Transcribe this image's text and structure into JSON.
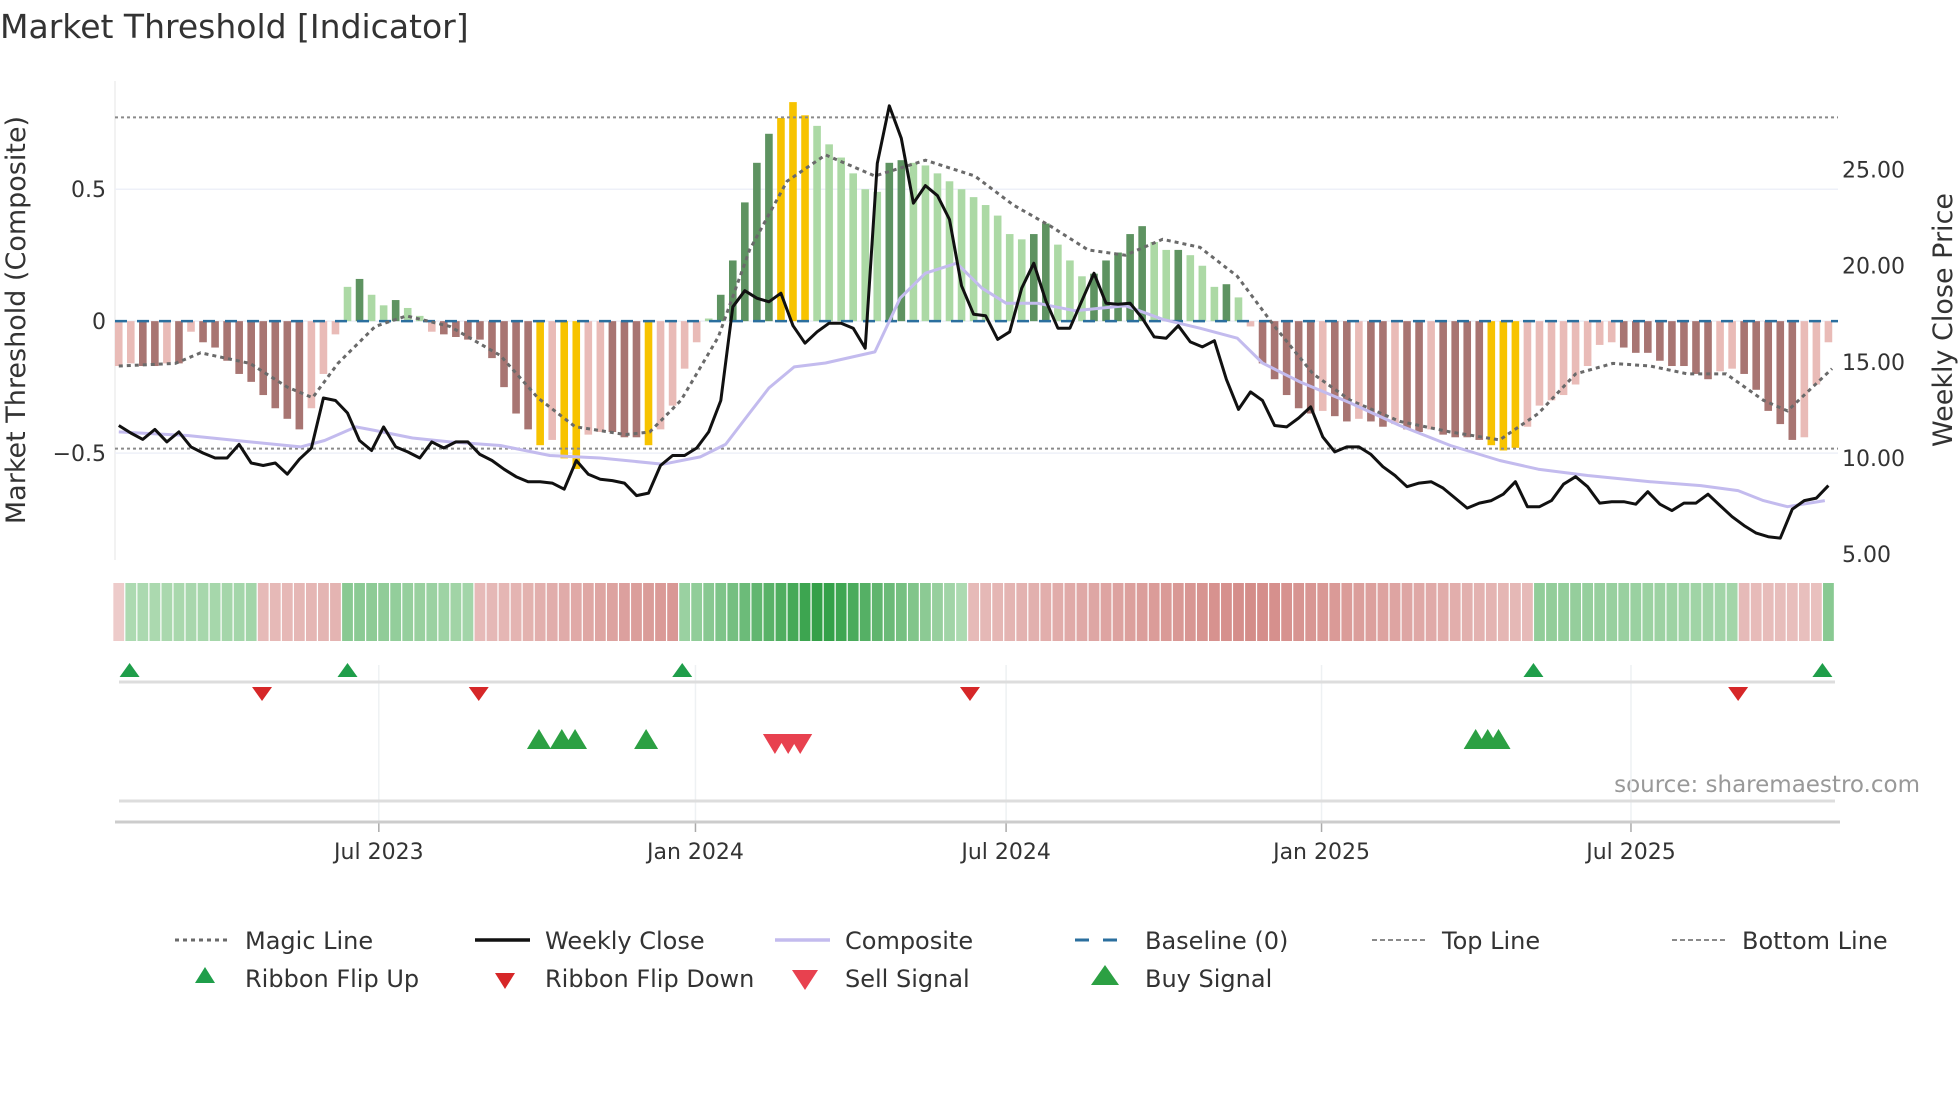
{
  "title": "Market Threshold [Indicator]",
  "source": "source: sharemaestro.com",
  "colors": {
    "bar_up_strong": "#5e9361",
    "bar_up_weak": "#acd9a5",
    "bar_down_strong": "#a87572",
    "bar_down_weak": "#e9bbb7",
    "bar_extreme": "#f7c300",
    "close": "#111111",
    "composite": "#c3bbee",
    "magic": "#6a6a6a",
    "baseline": "#2b6f9e",
    "threshold": "#8a8a8a",
    "flip_up": "#1f9e4a",
    "flip_down": "#d62728",
    "buy": "#2ca043",
    "sell": "#e8414f"
  },
  "chart_data": {
    "type": "bar+line",
    "title": "Market Threshold [Indicator]",
    "ylabel": "Market Threshold (Composite)",
    "y2label": "Weekly Close Price",
    "ylim": [
      -0.905,
      0.91
    ],
    "y2lim": [
      4.7,
      29.6
    ],
    "yticks": [
      {
        "v": 0.5,
        "label": "0.5"
      },
      {
        "v": 0,
        "label": "0"
      },
      {
        "v": -0.5,
        "label": "−0.5"
      }
    ],
    "y2ticks": [
      {
        "v": 25,
        "label": "25.00"
      },
      {
        "v": 20,
        "label": "20.00"
      },
      {
        "v": 15,
        "label": "15.00"
      },
      {
        "v": 10,
        "label": "10.00"
      },
      {
        "v": 5,
        "label": "5.00"
      }
    ],
    "xticks": [
      {
        "week": 21.6,
        "label": "Jul 2023"
      },
      {
        "week": 47.9,
        "label": "Jan 2024"
      },
      {
        "week": 73.7,
        "label": "Jul 2024"
      },
      {
        "week": 99.9,
        "label": "Jan 2025"
      },
      {
        "week": 125.6,
        "label": "Jul 2025"
      }
    ],
    "top_line": 0.772,
    "bottom_line": -0.483,
    "baseline": 0,
    "extreme_thresholds": [
      -0.465,
      0.75
    ],
    "composite_histogram": [
      -0.17,
      -0.16,
      -0.17,
      -0.17,
      -0.16,
      -0.16,
      -0.04,
      -0.08,
      -0.1,
      -0.15,
      -0.2,
      -0.23,
      -0.28,
      -0.33,
      -0.37,
      -0.41,
      -0.33,
      -0.2,
      -0.05,
      0.13,
      0.16,
      0.1,
      0.06,
      0.08,
      0.05,
      0.02,
      -0.04,
      -0.05,
      -0.06,
      -0.07,
      -0.07,
      -0.14,
      -0.25,
      -0.35,
      -0.41,
      -0.47,
      -0.45,
      -0.52,
      -0.56,
      -0.43,
      -0.42,
      -0.42,
      -0.44,
      -0.44,
      -0.47,
      -0.41,
      -0.32,
      -0.18,
      -0.08,
      0.01,
      0.1,
      0.23,
      0.45,
      0.6,
      0.71,
      0.77,
      0.83,
      0.78,
      0.74,
      0.67,
      0.62,
      0.56,
      0.5,
      0.49,
      0.6,
      0.61,
      0.6,
      0.59,
      0.56,
      0.53,
      0.5,
      0.47,
      0.44,
      0.4,
      0.33,
      0.31,
      0.33,
      0.37,
      0.29,
      0.23,
      0.17,
      0.18,
      0.23,
      0.26,
      0.33,
      0.36,
      0.3,
      0.27,
      0.27,
      0.25,
      0.21,
      0.13,
      0.14,
      0.09,
      -0.02,
      -0.16,
      -0.22,
      -0.28,
      -0.33,
      -0.35,
      -0.34,
      -0.36,
      -0.38,
      -0.37,
      -0.38,
      -0.4,
      -0.39,
      -0.41,
      -0.42,
      -0.41,
      -0.43,
      -0.44,
      -0.44,
      -0.45,
      -0.47,
      -0.49,
      -0.48,
      -0.4,
      -0.32,
      -0.3,
      -0.28,
      -0.24,
      -0.17,
      -0.09,
      -0.08,
      -0.1,
      -0.12,
      -0.12,
      -0.15,
      -0.17,
      -0.17,
      -0.2,
      -0.22,
      -0.19,
      -0.18,
      -0.2,
      -0.26,
      -0.34,
      -0.39,
      -0.45,
      -0.44,
      -0.24,
      -0.08
    ],
    "weekly_close": [
      11.69,
      11.3,
      10.97,
      11.49,
      10.84,
      11.36,
      10.58,
      10.26,
      10.0,
      10.0,
      10.71,
      9.74,
      9.61,
      9.74,
      9.16,
      9.94,
      10.52,
      13.12,
      12.99,
      12.34,
      10.91,
      10.39,
      11.62,
      10.58,
      10.32,
      10.0,
      10.84,
      10.52,
      10.84,
      10.84,
      10.19,
      9.87,
      9.42,
      9.03,
      8.77,
      8.77,
      8.7,
      8.38,
      9.87,
      9.16,
      8.9,
      8.83,
      8.7,
      8.05,
      8.18,
      9.61,
      10.13,
      10.13,
      10.52,
      11.36,
      12.99,
      17.86,
      18.7,
      18.31,
      18.12,
      18.57,
      16.88,
      15.97,
      16.56,
      17.01,
      17.01,
      16.75,
      15.71,
      25.32,
      28.31,
      26.62,
      23.25,
      24.16,
      23.64,
      22.4,
      18.96,
      17.47,
      17.4,
      16.17,
      16.56,
      18.83,
      20.13,
      18.18,
      16.75,
      16.75,
      18.18,
      19.61,
      18.05,
      17.99,
      18.05,
      17.27,
      16.3,
      16.23,
      16.88,
      16.04,
      15.78,
      16.1,
      14.09,
      12.53,
      13.44,
      12.99,
      11.69,
      11.62,
      12.08,
      12.66,
      11.1,
      10.32,
      10.58,
      10.58,
      10.19,
      9.55,
      9.09,
      8.51,
      8.7,
      8.77,
      8.44,
      7.92,
      7.4,
      7.66,
      7.79,
      8.12,
      8.77,
      7.47,
      7.47,
      7.79,
      8.64,
      9.03,
      8.51,
      7.66,
      7.73,
      7.73,
      7.6,
      8.25,
      7.6,
      7.27,
      7.66,
      7.66,
      8.12,
      7.53,
      6.95,
      6.49,
      6.1,
      5.91,
      5.84,
      7.34,
      7.79,
      7.92,
      8.57
    ],
    "composite_line": [
      [
        0,
        11.36
      ],
      [
        5.7,
        11.17
      ],
      [
        10.9,
        10.84
      ],
      [
        15.1,
        10.58
      ],
      [
        17.1,
        10.91
      ],
      [
        19.7,
        11.62
      ],
      [
        21.3,
        11.43
      ],
      [
        24.4,
        11.04
      ],
      [
        27.5,
        10.84
      ],
      [
        31.7,
        10.65
      ],
      [
        35.8,
        10.13
      ],
      [
        40.0,
        10.0
      ],
      [
        45.2,
        9.68
      ],
      [
        48.3,
        10.06
      ],
      [
        50.4,
        10.71
      ],
      [
        52.4,
        12.34
      ],
      [
        54.0,
        13.64
      ],
      [
        56.1,
        14.74
      ],
      [
        58.7,
        14.94
      ],
      [
        62.8,
        15.52
      ],
      [
        64.9,
        18.31
      ],
      [
        67.0,
        19.61
      ],
      [
        69.6,
        20.13
      ],
      [
        71.7,
        18.83
      ],
      [
        73.7,
        18.05
      ],
      [
        76.3,
        18.05
      ],
      [
        79.4,
        17.66
      ],
      [
        83.6,
        17.92
      ],
      [
        86.7,
        17.21
      ],
      [
        89.8,
        16.75
      ],
      [
        92.9,
        16.23
      ],
      [
        95.0,
        14.94
      ],
      [
        98.1,
        13.96
      ],
      [
        102.3,
        12.86
      ],
      [
        106.4,
        11.69
      ],
      [
        110.6,
        10.65
      ],
      [
        114.7,
        9.87
      ],
      [
        117.9,
        9.42
      ],
      [
        122.0,
        9.09
      ],
      [
        127.2,
        8.77
      ],
      [
        131.4,
        8.57
      ],
      [
        134.5,
        8.31
      ],
      [
        136.6,
        7.79
      ],
      [
        138.6,
        7.47
      ],
      [
        141.7,
        7.79
      ]
    ],
    "magic_line": [
      [
        0,
        -0.17
      ],
      [
        4.7,
        -0.16
      ],
      [
        6.8,
        -0.12
      ],
      [
        10.9,
        -0.16
      ],
      [
        14.0,
        -0.25
      ],
      [
        16.1,
        -0.29
      ],
      [
        18.2,
        -0.16
      ],
      [
        21.3,
        -0.02
      ],
      [
        23.9,
        0.02
      ],
      [
        27.5,
        -0.02
      ],
      [
        31.7,
        -0.13
      ],
      [
        34.8,
        -0.29
      ],
      [
        37.9,
        -0.4
      ],
      [
        42.1,
        -0.43
      ],
      [
        44.1,
        -0.42
      ],
      [
        46.7,
        -0.3
      ],
      [
        49.8,
        -0.06
      ],
      [
        52.4,
        0.27
      ],
      [
        55.5,
        0.53
      ],
      [
        58.7,
        0.63
      ],
      [
        62.8,
        0.55
      ],
      [
        67.0,
        0.61
      ],
      [
        71.1,
        0.55
      ],
      [
        74.3,
        0.44
      ],
      [
        77.4,
        0.36
      ],
      [
        80.5,
        0.27
      ],
      [
        83.6,
        0.25
      ],
      [
        86.7,
        0.31
      ],
      [
        89.8,
        0.28
      ],
      [
        92.9,
        0.17
      ],
      [
        96.0,
        -0.02
      ],
      [
        99.2,
        -0.2
      ],
      [
        102.3,
        -0.3
      ],
      [
        106.4,
        -0.38
      ],
      [
        110.6,
        -0.42
      ],
      [
        114.7,
        -0.45
      ],
      [
        117.9,
        -0.35
      ],
      [
        121.0,
        -0.2
      ],
      [
        124.1,
        -0.16
      ],
      [
        127.2,
        -0.17
      ],
      [
        130.3,
        -0.2
      ],
      [
        133.5,
        -0.2
      ],
      [
        136.6,
        -0.3
      ],
      [
        138.6,
        -0.34
      ],
      [
        142.3,
        -0.18
      ]
    ],
    "ribbon_segments": [
      {
        "start": 0,
        "end": 0,
        "dir": "down",
        "strength": [
          0.2,
          0.2
        ]
      },
      {
        "start": 1,
        "end": 11,
        "dir": "up",
        "strength": [
          0.3,
          0.35
        ]
      },
      {
        "start": 12,
        "end": 18,
        "dir": "down",
        "strength": [
          0.35,
          0.4
        ]
      },
      {
        "start": 19,
        "end": 29,
        "dir": "up",
        "strength": [
          0.5,
          0.35
        ]
      },
      {
        "start": 30,
        "end": 46,
        "dir": "down",
        "strength": [
          0.35,
          0.65
        ]
      },
      {
        "start": 47,
        "end": 70,
        "dir": "up",
        "strength": [
          0.4,
          1.0,
          0.3
        ]
      },
      {
        "start": 71,
        "end": 117,
        "dir": "down",
        "strength": [
          0.35,
          0.75,
          0.35
        ]
      },
      {
        "start": 118,
        "end": 134,
        "dir": "up",
        "strength": [
          0.45,
          0.35
        ]
      },
      {
        "start": 135,
        "end": 141,
        "dir": "down",
        "strength": [
          0.35,
          0.3
        ]
      },
      {
        "start": 142,
        "end": 142,
        "dir": "up",
        "strength": [
          0.5,
          0.5
        ]
      }
    ],
    "ribbon_flip_up": [
      0.9,
      19.0,
      46.8,
      117.5,
      141.5
    ],
    "ribbon_flip_down": [
      11.9,
      29.9,
      70.7,
      134.5
    ],
    "buy_signals": [
      34.9,
      36.8,
      37.9,
      43.8,
      112.7,
      113.7,
      114.6
    ],
    "sell_signals": [
      54.5,
      55.6,
      56.6
    ],
    "legend_position": "bottom"
  },
  "legend": [
    {
      "key": "magic",
      "label": "Magic Line"
    },
    {
      "key": "close",
      "label": "Weekly Close"
    },
    {
      "key": "composite",
      "label": "Composite"
    },
    {
      "key": "baseline",
      "label": "Baseline (0)"
    },
    {
      "key": "top",
      "label": "Top Line"
    },
    {
      "key": "bottom",
      "label": "Bottom Line"
    },
    {
      "key": "flip_up",
      "label": "Ribbon Flip Up"
    },
    {
      "key": "flip_down",
      "label": "Ribbon Flip Down"
    },
    {
      "key": "sell",
      "label": "Sell Signal"
    },
    {
      "key": "buy",
      "label": "Buy Signal"
    }
  ]
}
